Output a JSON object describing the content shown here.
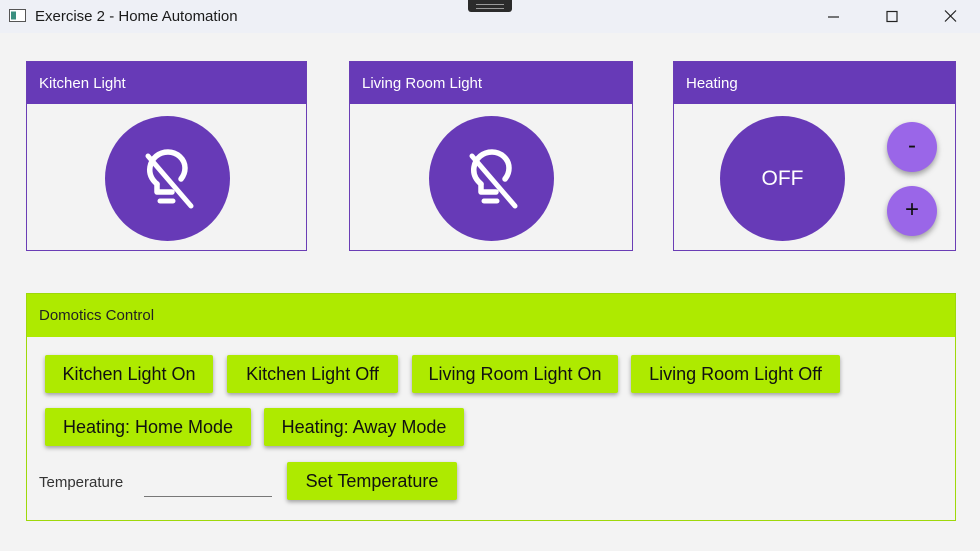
{
  "window": {
    "title": "Exercise 2 - Home Automation",
    "controls": [
      "minimize",
      "maximize",
      "close"
    ]
  },
  "cards": {
    "kitchen": {
      "title": "Kitchen Light",
      "icon": "lightbulb-off-icon"
    },
    "living_room": {
      "title": "Living Room Light",
      "icon": "lightbulb-off-icon"
    },
    "heating": {
      "title": "Heating",
      "status": "OFF",
      "minus_label": "-",
      "plus_label": "+"
    }
  },
  "control_panel": {
    "title": "Domotics Control",
    "buttons": [
      "Kitchen Light On",
      "Kitchen Light Off",
      "Living Room Light On",
      "Living Room Light Off",
      "Heating: Home Mode",
      "Heating: Away Mode"
    ],
    "temperature_label": "Temperature",
    "temperature_value": "",
    "set_temperature_label": "Set Temperature"
  },
  "colors": {
    "primary": "#673ab7",
    "primary_light": "#9a66e8",
    "accent": "#aeea00",
    "background": "#f3f3f3"
  }
}
